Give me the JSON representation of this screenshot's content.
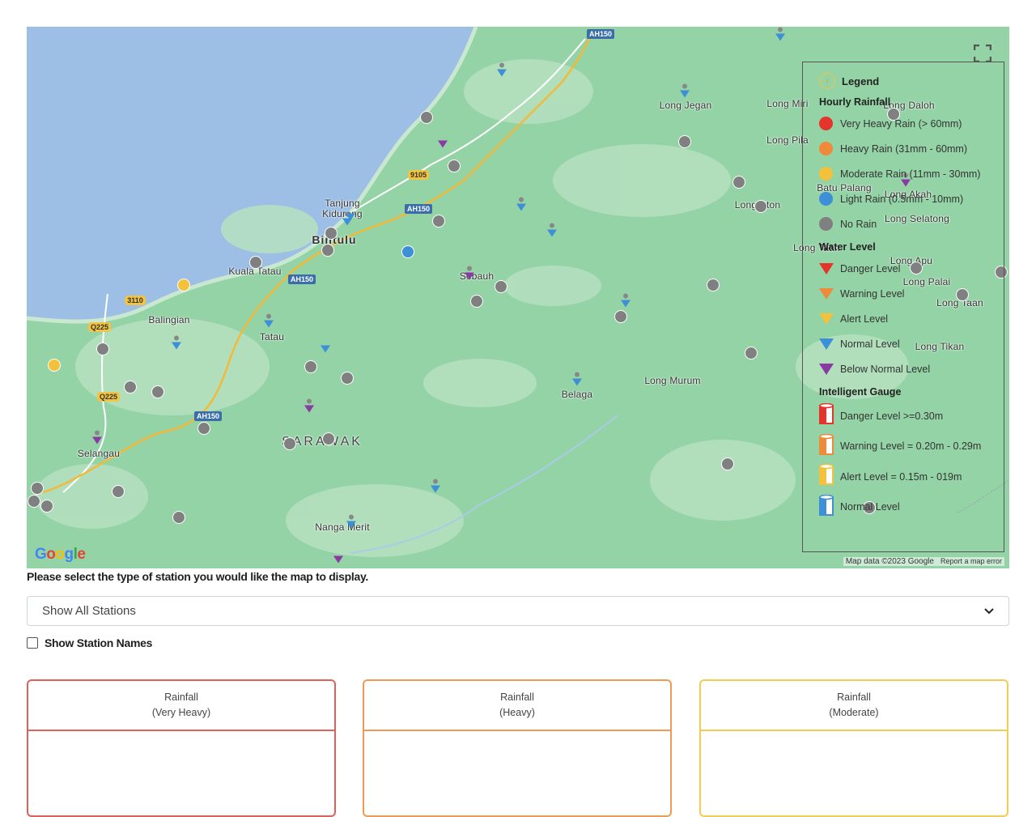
{
  "colors": {
    "very_heavy": "#e5342c",
    "heavy": "#ef8a3a",
    "moderate": "#f3c23a",
    "light": "#3d8fd8",
    "no_rain": "#808080",
    "below_normal": "#8a3aa2",
    "sea": "#9dbfe6",
    "land": "#94d3a6"
  },
  "map": {
    "places": [
      {
        "label": "Bintulu",
        "kind": "big"
      },
      {
        "label": "Tanjung Kidurong"
      },
      {
        "label": "Kuala Tatau"
      },
      {
        "label": "Tatau"
      },
      {
        "label": "Balingian"
      },
      {
        "label": "Selangau"
      },
      {
        "label": "Sebauh"
      },
      {
        "label": "SARAWAK",
        "kind": "region"
      },
      {
        "label": "Nanga Merit"
      },
      {
        "label": "Belaga"
      },
      {
        "label": "Long Murum"
      },
      {
        "label": "Long Jegan"
      },
      {
        "label": "Long Miri"
      },
      {
        "label": "Long Pila"
      },
      {
        "label": "Long Daloh"
      },
      {
        "label": "Batu Palang"
      },
      {
        "label": "Long Akah"
      },
      {
        "label": "Long Selatong"
      },
      {
        "label": "Long Bton"
      },
      {
        "label": "Long Taah"
      },
      {
        "label": "Long Apu"
      },
      {
        "label": "Long Palai"
      },
      {
        "label": "Long Taan"
      },
      {
        "label": "Long Tikan"
      }
    ],
    "shields": [
      "AH150",
      "AH150",
      "AH150",
      "AH150",
      "9105",
      "3110",
      "Q225",
      "Q225"
    ],
    "google_logo": "Google",
    "attribution": "Map data ©2023 Google",
    "report_link": "Report a map error"
  },
  "legend": {
    "title": "Legend",
    "hourly_title": "Hourly Rainfall",
    "hourly": [
      {
        "label": "Very Heavy Rain (> 60mm)",
        "color": "#e5342c"
      },
      {
        "label": "Heavy Rain (31mm - 60mm)",
        "color": "#ef8a3a"
      },
      {
        "label": "Moderate Rain (11mm - 30mm)",
        "color": "#f3c23a"
      },
      {
        "label": "Light Rain (0.5mm - 10mm)",
        "color": "#3d8fd8"
      },
      {
        "label": "No Rain",
        "color": "#808080"
      }
    ],
    "water_title": "Water Level",
    "water": [
      {
        "label": "Danger Level",
        "color": "#e5342c"
      },
      {
        "label": "Warning Level",
        "color": "#ef8a3a"
      },
      {
        "label": "Alert Level",
        "color": "#f3c23a"
      },
      {
        "label": "Normal Level",
        "color": "#3d8fd8"
      },
      {
        "label": "Below Normal Level",
        "color": "#8a3aa2"
      }
    ],
    "gauge_title": "Intelligent Gauge",
    "gauges": [
      {
        "label": "Danger Level >=0.30m",
        "color": "#e5342c"
      },
      {
        "label": "Warning Level = 0.20m - 0.29m",
        "color": "#ef8a3a"
      },
      {
        "label": "Alert Level = 0.15m - 019m",
        "color": "#f3c23a"
      },
      {
        "label": "Normal Level",
        "color": "#3d8fd8"
      }
    ]
  },
  "controls": {
    "select_prompt": "Please select the type of station you would like the map to display.",
    "select_value": "Show All Stations",
    "show_names_label": "Show Station Names"
  },
  "cards": [
    {
      "line1": "Rainfall",
      "line2": "(Very Heavy)",
      "color": "#e0615a"
    },
    {
      "line1": "Rainfall",
      "line2": "(Heavy)",
      "color": "#ef9a55"
    },
    {
      "line1": "Rainfall",
      "line2": "(Moderate)",
      "color": "#f3cd52"
    }
  ]
}
